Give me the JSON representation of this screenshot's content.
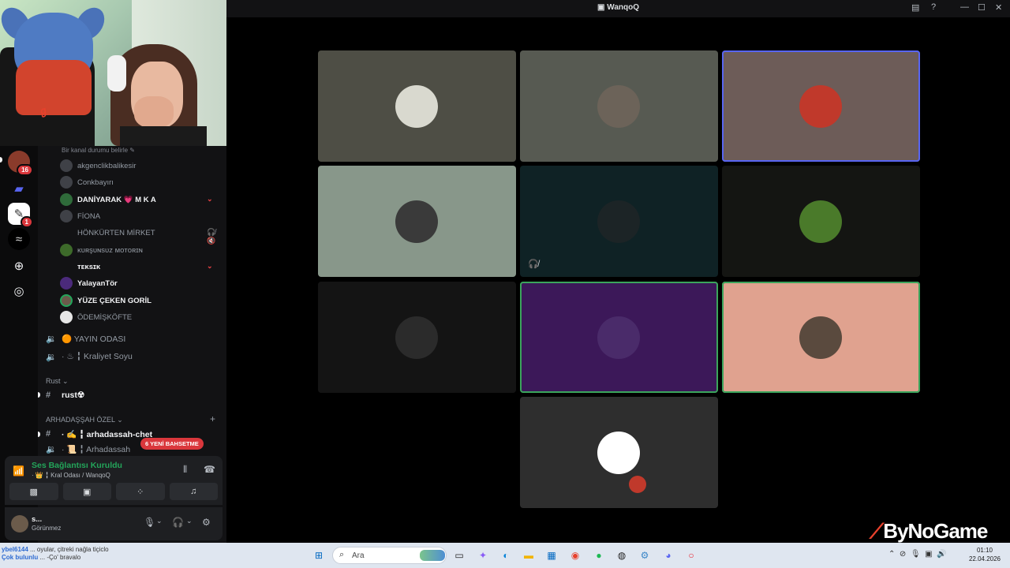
{
  "window": {
    "title": "WanqoQ"
  },
  "sidebar": {
    "status_hint": "Bir kanal durumu belirle ✎",
    "members": [
      {
        "name": "akgenclikbalikesir",
        "bold": false
      },
      {
        "name": "Conkbayırı",
        "bold": false
      },
      {
        "name": "DANİYARAK 💗 M K A",
        "bold": true,
        "side": "⌄"
      },
      {
        "name": "FİONA",
        "bold": false
      },
      {
        "name": "HÖNKÜRTEN MİRKET",
        "bold": false,
        "side": "🎧̸ 🔇"
      },
      {
        "name": "ᴋᴜʀşᴜɴsᴜᴢ ᴍᴏᴛᴏʀɪɴ",
        "bold": false
      },
      {
        "name": "ᴛᴇᴋsɪᴋ",
        "bold": true,
        "side": "⌄"
      },
      {
        "name": "YalayanTör",
        "bold": true
      },
      {
        "name": "YÜZE ÇEKEN GORİL",
        "bold": true
      },
      {
        "name": "ÖDEMİŞKÖFTE",
        "bold": false
      }
    ],
    "voice_channels": [
      {
        "name": "🟠 YAYIN ODASI"
      },
      {
        "name": "· ♨ ╏ Kraliyet Soyu"
      }
    ],
    "categories": [
      {
        "name": "Rust ⌄"
      },
      {
        "name": "ARHADAŞŞAH ÖZEL ⌄"
      }
    ],
    "text_channels": [
      {
        "name": "rust☢"
      },
      {
        "name": "· ✍ ╏ arhadassah-chet"
      },
      {
        "name": "· 📜 ╏ Arhadassah"
      }
    ],
    "mention_pill": "6 YENİ BAHSETME",
    "rail": {
      "badge_1": "16",
      "badge_2": "1"
    },
    "voice_panel": {
      "title": "Ses Bağlantısı Kuruldu",
      "subtitle": "· 👑 ╏ Kral Odası / WanqoQ"
    },
    "user": {
      "name": "s...",
      "status": "Görünmez"
    }
  },
  "grid": {
    "tiles": [
      {
        "bg": "#4e4e45",
        "avatar": "#d9d9cf"
      },
      {
        "bg": "#575a52",
        "avatar": "#6c6359"
      },
      {
        "bg": "#6d5c58",
        "avatar": "#c0392b",
        "selected": true
      },
      {
        "bg": "#88978a",
        "avatar": "#3a3a3a"
      },
      {
        "bg": "#0f2225",
        "avatar": "#1c2426",
        "muted": true
      },
      {
        "bg": "#141512",
        "avatar": "#4a7a2a"
      },
      {
        "bg": "#141414",
        "avatar": "#2b2b2b"
      },
      {
        "bg": "#3c1859",
        "avatar": "#4a2b6a",
        "speaking": true
      },
      {
        "bg": "#e0a28f",
        "avatar": "#5a4a3e",
        "speaking": true
      },
      {
        "bg": "#2e2e2e",
        "avatar": "#ffffff"
      }
    ],
    "mute_glyph": "🎧̸"
  },
  "watermark": "ByNoGame",
  "taskbar": {
    "search_placeholder": "Ara",
    "time": "01:10",
    "date": "22.04.2026",
    "notice_line1_name": "ybel6144",
    "notice_line1_text": " ... oyular, çitreki nağla tiçiclo",
    "notice_line2_name": "Çok bulunlu",
    "notice_line2_text": " ... -Ço' bravalo"
  },
  "colors": {
    "accent": "#5865f2",
    "speaking": "#3ba55c",
    "voice_connected": "#23a55a",
    "mention": "#da373c"
  }
}
